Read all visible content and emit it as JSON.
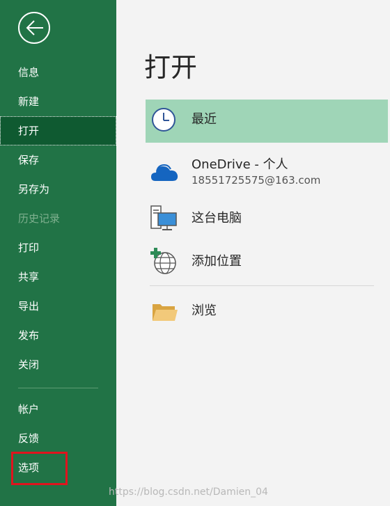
{
  "sidebar": {
    "items": [
      {
        "label": "信息"
      },
      {
        "label": "新建"
      },
      {
        "label": "打开"
      },
      {
        "label": "保存"
      },
      {
        "label": "另存为"
      },
      {
        "label": "历史记录"
      },
      {
        "label": "打印"
      },
      {
        "label": "共享"
      },
      {
        "label": "导出"
      },
      {
        "label": "发布"
      },
      {
        "label": "关闭"
      }
    ],
    "bottom_items": [
      {
        "label": "帐户"
      },
      {
        "label": "反馈"
      },
      {
        "label": "选项"
      }
    ]
  },
  "main": {
    "title": "打开",
    "locations": [
      {
        "label": "最近",
        "icon": "clock-icon"
      },
      {
        "label": "OneDrive - 个人",
        "sublabel": "18551725575@163.com",
        "icon": "onedrive-cloud-icon"
      },
      {
        "label": "这台电脑",
        "icon": "computer-icon"
      },
      {
        "label": "添加位置",
        "icon": "add-location-globe-icon"
      },
      {
        "label": "浏览",
        "icon": "folder-icon"
      }
    ]
  },
  "watermark": "https://blog.csdn.net/Damien_04",
  "colors": {
    "sidebar_bg": "#217346",
    "active_item_bg": "#0f5a31",
    "selected_location_bg": "#9fd5b7",
    "highlight_border": "#e0141e"
  }
}
